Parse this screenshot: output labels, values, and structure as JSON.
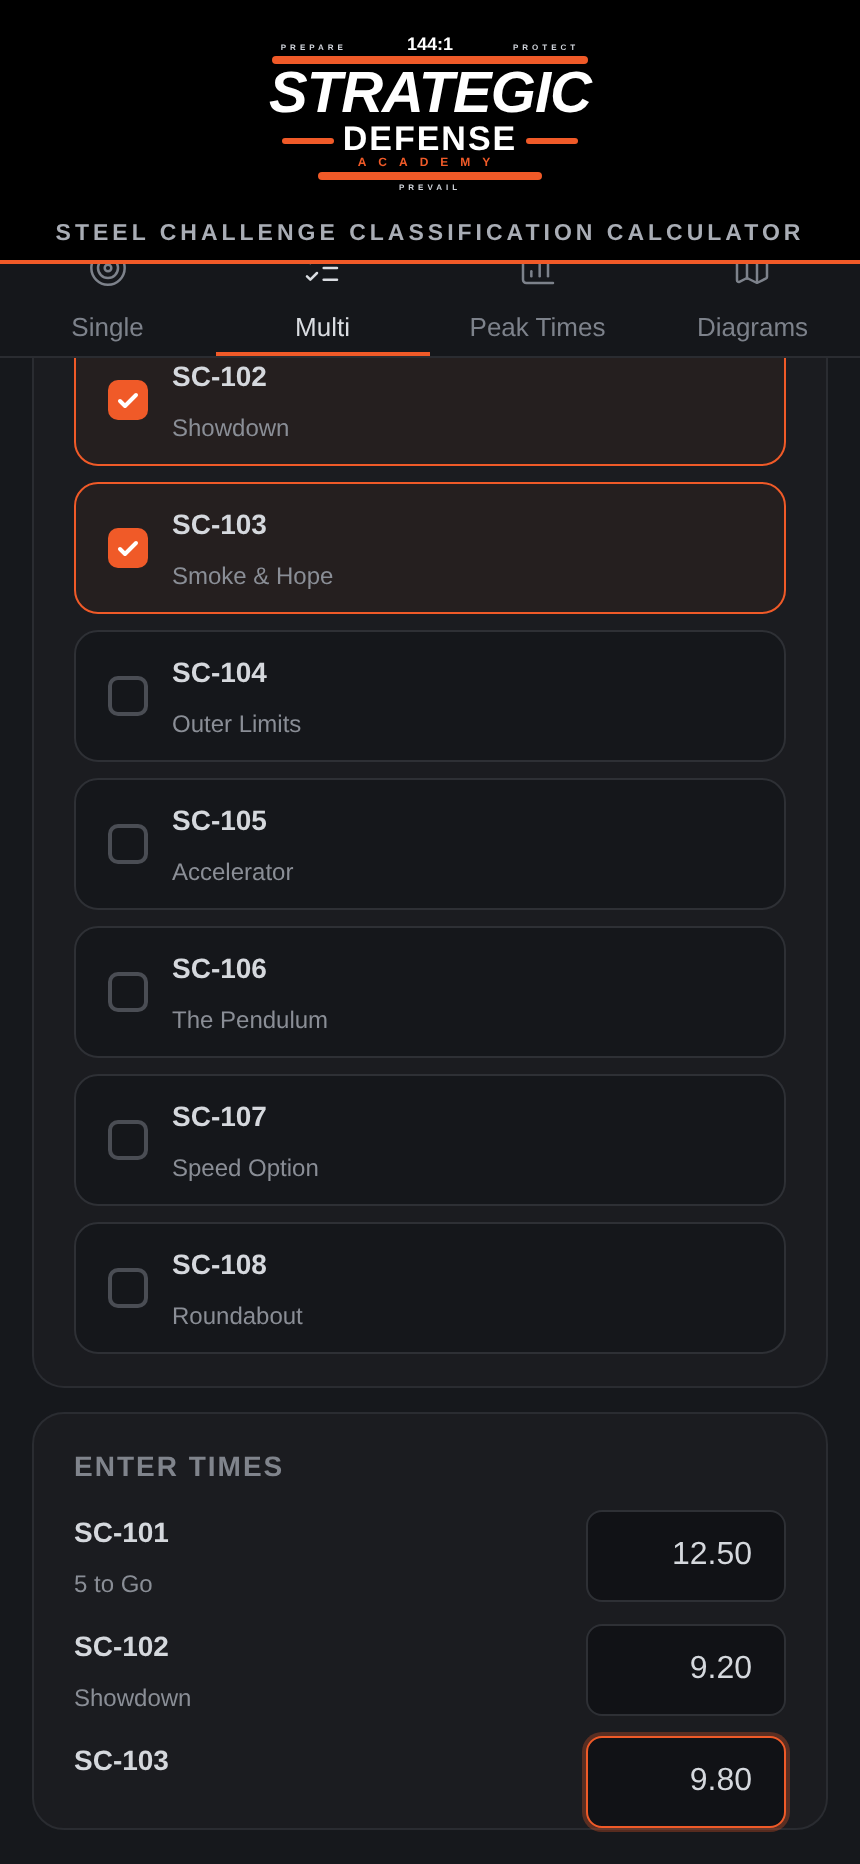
{
  "logo": {
    "ratio": "144:1",
    "left_tag": "PREPARE",
    "right_tag": "PROTECT",
    "line1": "STRATEGIC",
    "line2": "DEFENSE",
    "line3": "ACADEMY",
    "bottom_tag": "PREVAIL"
  },
  "subtitle": "STEEL CHALLENGE CLASSIFICATION CALCULATOR",
  "tabs": [
    {
      "label": "Single",
      "kind": "target",
      "selected": false
    },
    {
      "label": "Multi",
      "kind": "list",
      "selected": true
    },
    {
      "label": "Peak Times",
      "kind": "chart",
      "selected": false
    },
    {
      "label": "Diagrams",
      "kind": "map",
      "selected": false
    }
  ],
  "stages": [
    {
      "code": "SC-102",
      "name": "Showdown",
      "checked": true
    },
    {
      "code": "SC-103",
      "name": "Smoke & Hope",
      "checked": true
    },
    {
      "code": "SC-104",
      "name": "Outer Limits",
      "checked": false
    },
    {
      "code": "SC-105",
      "name": "Accelerator",
      "checked": false
    },
    {
      "code": "SC-106",
      "name": "The Pendulum",
      "checked": false
    },
    {
      "code": "SC-107",
      "name": "Speed Option",
      "checked": false
    },
    {
      "code": "SC-108",
      "name": "Roundabout",
      "checked": false
    }
  ],
  "times": {
    "heading": "ENTER TIMES",
    "rows": [
      {
        "code": "SC-101",
        "name": "5 to Go",
        "value": "12.50",
        "focused": false
      },
      {
        "code": "SC-102",
        "name": "Showdown",
        "value": "9.20",
        "focused": false
      },
      {
        "code": "SC-103",
        "value": "9.80",
        "focused": true
      }
    ]
  }
}
